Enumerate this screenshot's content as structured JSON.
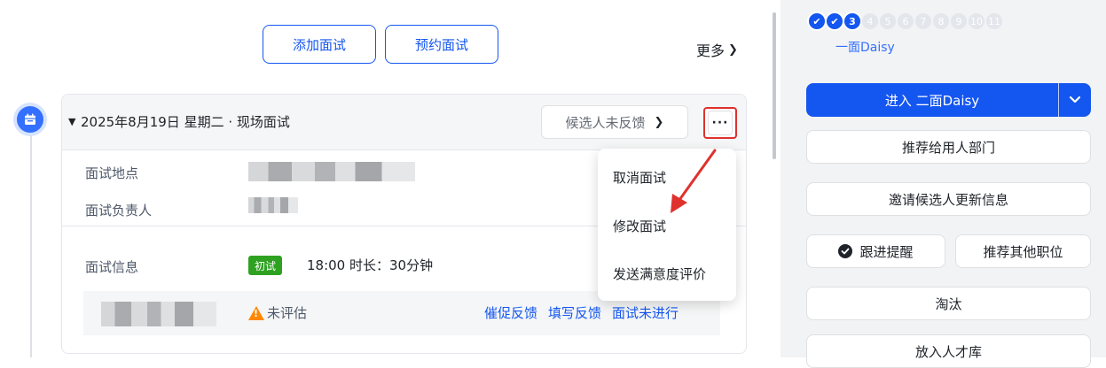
{
  "top_actions": {
    "add_interview": "添加面试",
    "schedule_interview": "预约面试",
    "more": "更多"
  },
  "interview": {
    "title": "2025年8月19日 星期二 · 现场面试",
    "feedback_status": "候选人未反馈",
    "location_label": "面试地点",
    "owner_label": "面试负责人",
    "info_label": "面试信息",
    "round_tag": "初试",
    "time_info": "18:00  时长：30分钟",
    "eval_status": "未评估",
    "actions": [
      "催促反馈",
      "填写反馈",
      "面试未进行"
    ]
  },
  "menu": {
    "items": [
      "取消面试",
      "修改面试",
      "发送满意度评价"
    ]
  },
  "stages": {
    "done": [
      "",
      ""
    ],
    "current": "3",
    "todo": [
      "4",
      "5",
      "6",
      "7",
      "8",
      "9",
      "10",
      "11"
    ],
    "current_label": "一面Daisy"
  },
  "sidebar": {
    "primary": "进入 二面Daisy",
    "recommend_dept": "推荐给用人部门",
    "invite_update": "邀请候选人更新信息",
    "follow_up": "跟进提醒",
    "recommend_other": "推荐其他职位",
    "reject": "淘汰",
    "talent_pool": "放入人才库"
  },
  "colors": {
    "accent": "#1456f0",
    "tag_green": "#2ea121",
    "warning": "#ff8800",
    "highlight_red": "#e0312d"
  }
}
